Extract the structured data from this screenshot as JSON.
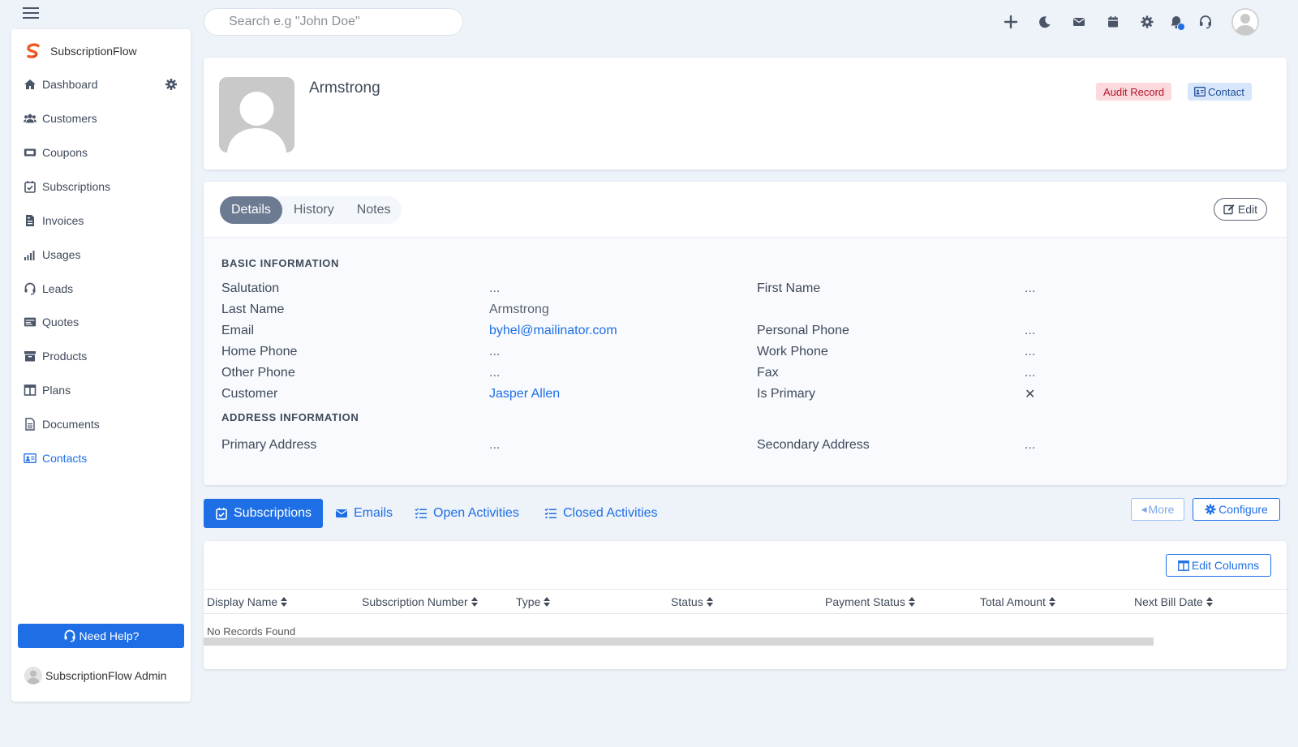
{
  "colors": {
    "accent": "#1e6fe6",
    "background": "#eef2f9",
    "audit_badge_bg": "#fbd9dd",
    "audit_badge_text": "#b0172a",
    "contact_badge_bg": "#d7e6fb",
    "active_tab": "#6c7b91"
  },
  "header": {
    "menu_icon": "hamburger-icon",
    "search_placeholder": "Search e.g \"John Doe\"",
    "icons": [
      "plus-icon",
      "moon-icon",
      "envelope-icon",
      "calendar-icon",
      "gear-icon",
      "bell-icon",
      "headset-icon",
      "user-avatar"
    ]
  },
  "sidebar": {
    "brand_name": "SubscriptionFlow",
    "items": [
      {
        "label": "Dashboard",
        "icon": "home-icon"
      },
      {
        "label": "Customers",
        "icon": "users-icon"
      },
      {
        "label": "Coupons",
        "icon": "ticket-icon"
      },
      {
        "label": "Subscriptions",
        "icon": "calendar-check-icon"
      },
      {
        "label": "Invoices",
        "icon": "invoice-icon"
      },
      {
        "label": "Usages",
        "icon": "signal-icon"
      },
      {
        "label": "Leads",
        "icon": "headset-icon"
      },
      {
        "label": "Quotes",
        "icon": "quote-icon"
      },
      {
        "label": "Products",
        "icon": "archive-icon"
      },
      {
        "label": "Plans",
        "icon": "columns-icon"
      },
      {
        "label": "Documents",
        "icon": "document-icon"
      },
      {
        "label": "Contacts",
        "icon": "id-card-icon",
        "active": true
      }
    ],
    "help_label": "Need Help?",
    "admin_name": "SubscriptionFlow Admin"
  },
  "profile": {
    "name": "Armstrong",
    "badges": {
      "audit": "Audit Record",
      "contact": "Contact"
    }
  },
  "details": {
    "tabs": [
      "Details",
      "History",
      "Notes"
    ],
    "active_tab": "Details",
    "edit_label": "Edit",
    "basic_title": "BASIC INFORMATION",
    "address_title": "ADDRESS INFORMATION",
    "fields": {
      "salutation": {
        "label": "Salutation",
        "value": "..."
      },
      "first_name": {
        "label": "First Name",
        "value": "..."
      },
      "last_name": {
        "label": "Last Name",
        "value": "Armstrong"
      },
      "email": {
        "label": "Email",
        "value": "byhel@mailinator.com"
      },
      "personal_phone": {
        "label": "Personal Phone",
        "value": "..."
      },
      "home_phone": {
        "label": "Home Phone",
        "value": "..."
      },
      "work_phone": {
        "label": "Work Phone",
        "value": "..."
      },
      "other_phone": {
        "label": "Other Phone",
        "value": "..."
      },
      "fax": {
        "label": "Fax",
        "value": "..."
      },
      "customer": {
        "label": "Customer",
        "value": "Jasper Allen"
      },
      "is_primary": {
        "label": "Is Primary",
        "value": "✕"
      },
      "primary_address": {
        "label": "Primary Address",
        "value": "..."
      },
      "secondary_address": {
        "label": "Secondary Address",
        "value": "..."
      }
    }
  },
  "related": {
    "tabs": [
      {
        "label": "Subscriptions",
        "icon": "calendar-check-icon",
        "active": true
      },
      {
        "label": "Emails",
        "icon": "envelope-icon"
      },
      {
        "label": "Open Activities",
        "icon": "tasks-icon"
      },
      {
        "label": "Closed Activities",
        "icon": "tasks-icon"
      }
    ],
    "more_label": "More",
    "configure_label": "Configure",
    "edit_columns_label": "Edit Columns",
    "columns": [
      "Display Name",
      "Subscription Number",
      "Type",
      "Status",
      "Payment Status",
      "Total Amount",
      "Next Bill Date"
    ],
    "empty_text": "No Records Found"
  }
}
